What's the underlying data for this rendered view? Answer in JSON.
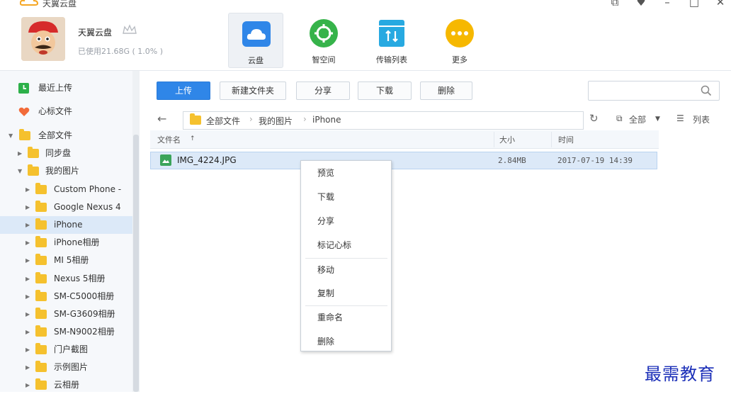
{
  "app": {
    "title": "天翼云盘"
  },
  "window_controls": [
    "⧉",
    "♥",
    "–",
    "□",
    "✕"
  ],
  "user": {
    "name": "天翼云盘",
    "usage": "已使用21.68G ( 1.0% )"
  },
  "nav": [
    {
      "label": "云盘",
      "icon": "cloud-icon",
      "color": "#2f86e8"
    },
    {
      "label": "智空间",
      "icon": "target-icon",
      "color": "#36b34a"
    },
    {
      "label": "传输列表",
      "icon": "transfer-icon",
      "color": "#27a9e1"
    },
    {
      "label": "更多",
      "icon": "more-icon",
      "color": "#f6b800"
    }
  ],
  "sidebar": {
    "recent": "最近上传",
    "favorites": "心标文件",
    "all_files": "全部文件",
    "sync": "同步盘",
    "my_photos": "我的图片",
    "folders": [
      "Custom Phone -",
      "Google Nexus 4",
      "iPhone",
      "iPhone相册",
      "MI 5相册",
      "Nexus 5相册",
      "SM-C5000相册",
      "SM-G3609相册",
      "SM-N9002相册",
      "门户截图",
      "示例图片",
      "云相册"
    ]
  },
  "toolbar": {
    "upload": "上传",
    "new_folder": "新建文件夹",
    "share": "分享",
    "download": "下载",
    "delete": "删除"
  },
  "path": {
    "root": "全部文件",
    "level1": "我的图片",
    "level2": "iPhone"
  },
  "view": {
    "filter": "全部",
    "list": "列表"
  },
  "columns": {
    "name": "文件名",
    "size": "大小",
    "time": "时间"
  },
  "file": {
    "name": "IMG_4224.JPG",
    "size": "2.84MB",
    "time": "2017-07-19 14:39"
  },
  "context_menu": [
    "预览",
    "下载",
    "分享",
    "标记心标",
    "移动",
    "复制",
    "重命名",
    "删除"
  ],
  "watermark": "最需教育"
}
